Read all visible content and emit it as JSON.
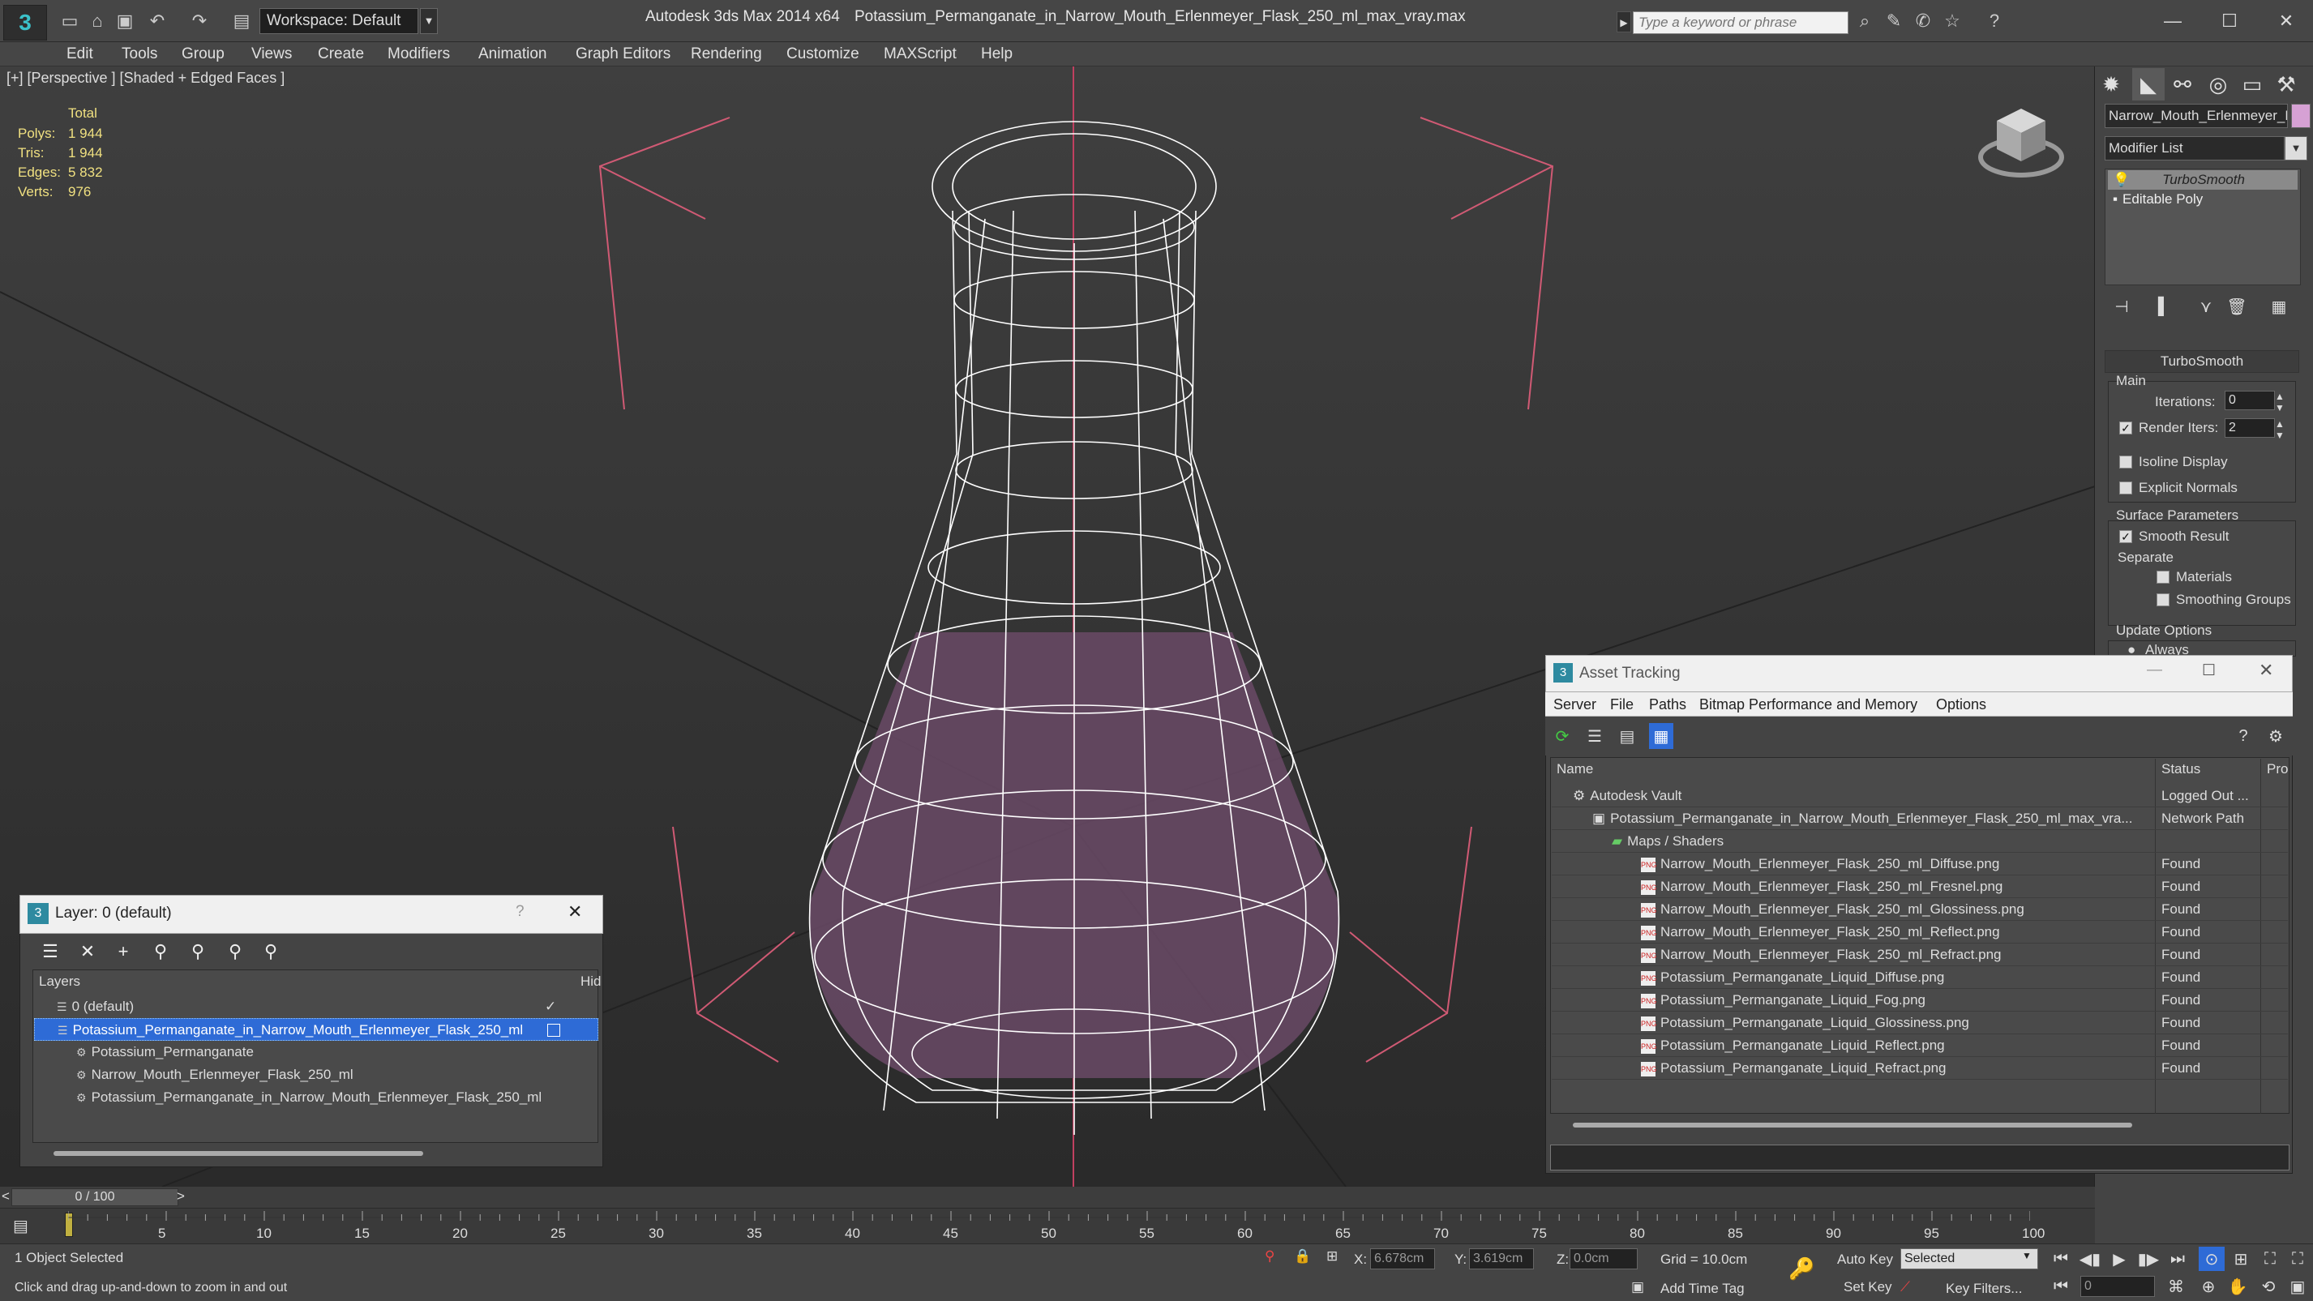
{
  "title_bar": {
    "workspace": "Workspace: Default",
    "app_title": "Autodesk 3ds Max  2014 x64",
    "file_title": "Potassium_Permanganate_in_Narrow_Mouth_Erlenmeyer_Flask_250_ml_max_vray.max",
    "search_placeholder": "Type a keyword or phrase"
  },
  "menu": [
    "Edit",
    "Tools",
    "Group",
    "Views",
    "Create",
    "Modifiers",
    "Animation",
    "Graph Editors",
    "Rendering",
    "Customize",
    "MAXScript",
    "Help"
  ],
  "viewport": {
    "label": "[+] [Perspective ] [Shaded + Edged Faces ]",
    "stats": {
      "total_label": "Total",
      "rows": [
        {
          "label": "Polys:",
          "value": "1 944"
        },
        {
          "label": "Tris:",
          "value": "1 944"
        },
        {
          "label": "Edges:",
          "value": "5 832"
        },
        {
          "label": "Verts:",
          "value": "976"
        }
      ]
    }
  },
  "command_panel": {
    "object_name": "Narrow_Mouth_Erlenmeyer_F",
    "object_color": "#d6a1d4",
    "modifier_list": "Modifier List",
    "stack": [
      "TurboSmooth",
      "Editable Poly"
    ],
    "rollout_title": "TurboSmooth",
    "main_label": "Main",
    "iterations_label": "Iterations:",
    "iterations_value": "0",
    "render_iters_label": "Render Iters:",
    "render_iters_value": "2",
    "isoline_label": "Isoline Display",
    "explicit_label": "Explicit Normals",
    "surface_label": "Surface Parameters",
    "smooth_label": "Smooth Result",
    "separate_label": "Separate",
    "materials_label": "Materials",
    "smoothing_label": "Smoothing Groups",
    "update_label": "Update Options",
    "always_label": "Always"
  },
  "layer_dialog": {
    "title": "Layer: 0 (default)",
    "help": "?",
    "col_layers": "Layers",
    "col_hide": "Hid",
    "rows": [
      {
        "name": "0 (default)",
        "level": 0,
        "selected": false
      },
      {
        "name": "Potassium_Permanganate_in_Narrow_Mouth_Erlenmeyer_Flask_250_ml",
        "level": 0,
        "selected": true
      },
      {
        "name": "Potassium_Permanganate",
        "level": 1,
        "selected": false
      },
      {
        "name": "Narrow_Mouth_Erlenmeyer_Flask_250_ml",
        "level": 1,
        "selected": false
      },
      {
        "name": "Potassium_Permanganate_in_Narrow_Mouth_Erlenmeyer_Flask_250_ml",
        "level": 1,
        "selected": false
      }
    ]
  },
  "asset_tracking": {
    "title": "Asset Tracking",
    "menu": [
      "Server",
      "File",
      "Paths",
      "Bitmap Performance and Memory",
      "Options"
    ],
    "col_name": "Name",
    "col_status": "Status",
    "col_pro": "Pro",
    "rows": [
      {
        "name": "Autodesk Vault",
        "status": "Logged Out ...",
        "indent": 0,
        "kind": "vault"
      },
      {
        "name": "Potassium_Permanganate_in_Narrow_Mouth_Erlenmeyer_Flask_250_ml_max_vra...",
        "status": "Network Path",
        "indent": 1,
        "kind": "max"
      },
      {
        "name": "Maps / Shaders",
        "status": "",
        "indent": 2,
        "kind": "folder"
      },
      {
        "name": "Narrow_Mouth_Erlenmeyer_Flask_250_ml_Diffuse.png",
        "status": "Found",
        "indent": 3,
        "kind": "png"
      },
      {
        "name": "Narrow_Mouth_Erlenmeyer_Flask_250_ml_Fresnel.png",
        "status": "Found",
        "indent": 3,
        "kind": "png"
      },
      {
        "name": "Narrow_Mouth_Erlenmeyer_Flask_250_ml_Glossiness.png",
        "status": "Found",
        "indent": 3,
        "kind": "png"
      },
      {
        "name": "Narrow_Mouth_Erlenmeyer_Flask_250_ml_Reflect.png",
        "status": "Found",
        "indent": 3,
        "kind": "png"
      },
      {
        "name": "Narrow_Mouth_Erlenmeyer_Flask_250_ml_Refract.png",
        "status": "Found",
        "indent": 3,
        "kind": "png"
      },
      {
        "name": "Potassium_Permanganate_Liquid_Diffuse.png",
        "status": "Found",
        "indent": 3,
        "kind": "png"
      },
      {
        "name": "Potassium_Permanganate_Liquid_Fog.png",
        "status": "Found",
        "indent": 3,
        "kind": "png"
      },
      {
        "name": "Potassium_Permanganate_Liquid_Glossiness.png",
        "status": "Found",
        "indent": 3,
        "kind": "png"
      },
      {
        "name": "Potassium_Permanganate_Liquid_Reflect.png",
        "status": "Found",
        "indent": 3,
        "kind": "png"
      },
      {
        "name": "Potassium_Permanganate_Liquid_Refract.png",
        "status": "Found",
        "indent": 3,
        "kind": "png"
      }
    ]
  },
  "timeline": {
    "frame": "0 / 100",
    "ticks": [
      "5",
      "10",
      "15",
      "20",
      "25",
      "30",
      "35",
      "40",
      "45",
      "50",
      "55",
      "60",
      "65",
      "70",
      "75",
      "80",
      "85",
      "90",
      "95",
      "100"
    ]
  },
  "status": {
    "selection": "1 Object Selected",
    "prompt": "Click and drag up-and-down to zoom in and out",
    "x_label": "X:",
    "x_value": "6.678cm",
    "y_label": "Y:",
    "y_value": "3.619cm",
    "z_label": "Z:",
    "z_value": "0.0cm",
    "grid": "Grid = 10.0cm",
    "auto_key": "Auto Key",
    "selected": "Selected",
    "set_key": "Set Key",
    "key_filters": "Key Filters...",
    "add_time_tag": "Add Time Tag",
    "frame_value": "0"
  },
  "colors": {
    "wire": "#ffffff",
    "liquid": "#6a4a66",
    "selection": "#2e6bd6",
    "gizmo": "#d05a74"
  }
}
